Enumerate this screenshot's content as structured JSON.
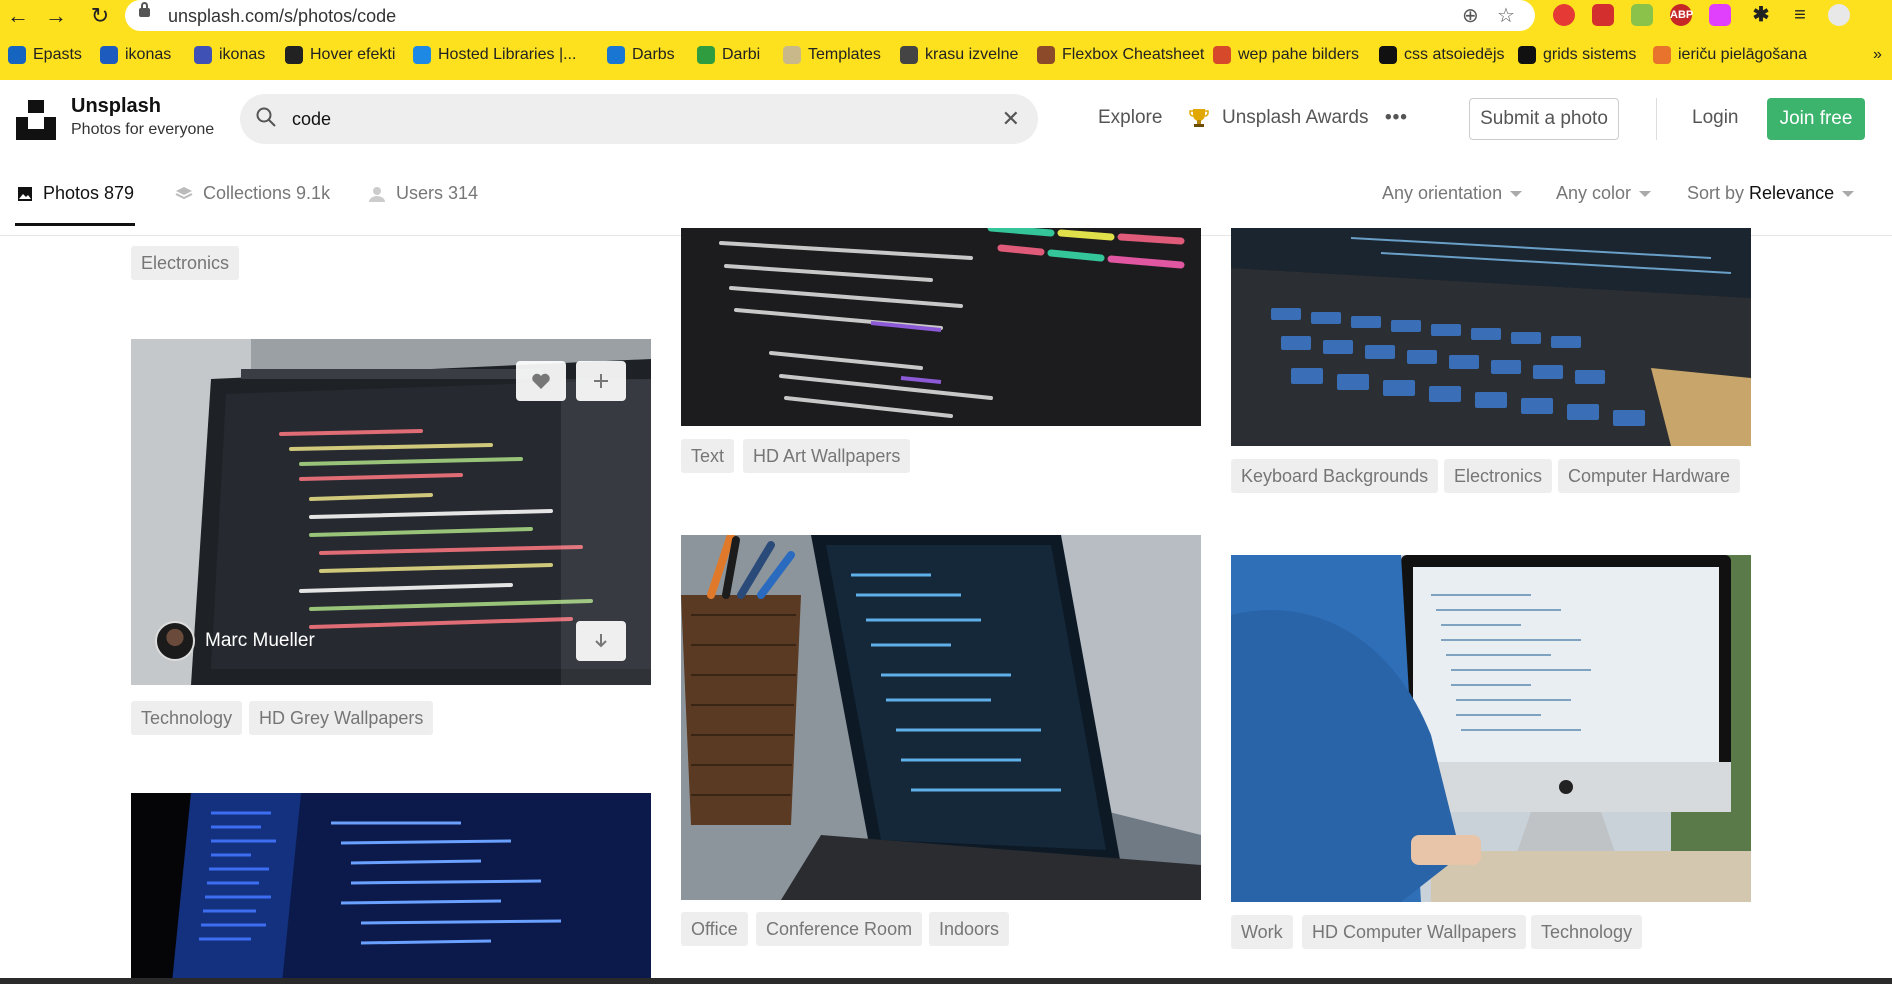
{
  "browser": {
    "url": "unsplash.com/s/photos/code",
    "bookmarks": [
      {
        "label": "Epasts",
        "color": "#1565c0"
      },
      {
        "label": "ikonas",
        "color": "#1e5bbf"
      },
      {
        "label": "ikonas",
        "color": "#3f51b5"
      },
      {
        "label": "Hover efekti",
        "color": "#222222"
      },
      {
        "label": "Hosted Libraries |...",
        "color": "#1e88e5"
      },
      {
        "label": "Darbs",
        "color": "#1976d2"
      },
      {
        "label": "Darbi",
        "color": "#2e9c3f"
      },
      {
        "label": "Templates",
        "color": "#c9b98a"
      },
      {
        "label": "krasu izvelne",
        "color": "#444444"
      },
      {
        "label": "Flexbox Cheatsheet",
        "color": "#8d4a2a"
      },
      {
        "label": "wep pahe bilders",
        "color": "#d64a2b"
      },
      {
        "label": "css atsoiedējs",
        "color": "#111111"
      },
      {
        "label": "grids sistems",
        "color": "#111111"
      },
      {
        "label": "ieriču pielāgošana",
        "color": "#e8732c"
      }
    ],
    "more_glyph": "»"
  },
  "header": {
    "brand_name": "Unsplash",
    "brand_tagline": "Photos for everyone",
    "search_value": "code",
    "nav": {
      "explore": "Explore",
      "awards": "Unsplash Awards",
      "more": "•••",
      "submit": "Submit a photo",
      "login": "Login",
      "join": "Join free"
    },
    "accent": "#3cb46e"
  },
  "tabs": {
    "photos": "Photos 879",
    "collections": "Collections 9.1k",
    "users": "Users 314"
  },
  "filters": {
    "orientation": "Any orientation",
    "color": "Any color",
    "sort_prefix": "Sort by",
    "sort_value": "Relevance"
  },
  "column1": {
    "top_tag": "Electronics",
    "photo1_author": "Marc Mueller",
    "photo1_tags": [
      "Technology",
      "HD Grey Wallpapers"
    ]
  },
  "column2": {
    "photo1_tags": [
      "Text",
      "HD Art Wallpapers"
    ],
    "photo2_tags": [
      "Office",
      "Conference Room",
      "Indoors"
    ]
  },
  "column3": {
    "photo1_tags": [
      "Keyboard Backgrounds",
      "Electronics",
      "Computer Hardware"
    ],
    "photo2_tags": [
      "Work",
      "HD Computer Wallpapers",
      "Technology"
    ]
  }
}
